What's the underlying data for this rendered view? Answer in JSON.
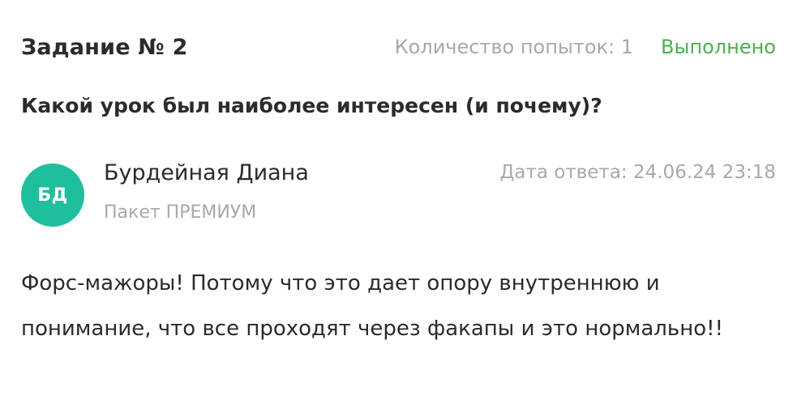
{
  "task": {
    "title": "Задание № 2",
    "attempts": "Количество попыток: 1",
    "status": "Выполнено",
    "status_color": "#4caf50"
  },
  "question": "Какой урок был наиболее интересен (и почему)?",
  "answer": {
    "avatar_initials": "БД",
    "avatar_color": "#1fbf9d",
    "author_name": "Бурдейная Диана",
    "author_plan": "Пакет ПРЕМИУМ",
    "date": "Дата ответа: 24.06.24 23:18",
    "text": "Форс-мажоры! Потому что это дает опору внутреннюю и понимание, что все проходят через факапы и это нормально!!"
  }
}
